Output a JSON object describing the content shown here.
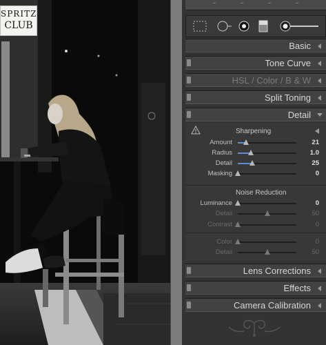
{
  "photo": {
    "sign_line1": "SPRITZ",
    "sign_line2": "CLUB"
  },
  "toolbar": {
    "tools": [
      "crop-overlay-icon",
      "spot-removal-icon",
      "red-eye-icon",
      "graduated-filter-icon",
      "adjustment-brush-icon"
    ]
  },
  "panel": {
    "sections": {
      "basic": "Basic",
      "tone_curve": "Tone Curve",
      "hsl": "HSL",
      "slash1": "/",
      "color": "Color",
      "slash2": "/",
      "bw": "B & W",
      "split_toning": "Split Toning",
      "detail": "Detail",
      "lens_corrections": "Lens Corrections",
      "effects": "Effects",
      "camera_calibration": "Camera Calibration"
    },
    "sharpening": {
      "title": "Sharpening",
      "rows": [
        {
          "name": "Amount",
          "value": "21",
          "fraction": 0.14
        },
        {
          "name": "Radius",
          "value": "1.0",
          "fraction": 0.22
        },
        {
          "name": "Detail",
          "value": "25",
          "fraction": 0.25
        },
        {
          "name": "Masking",
          "value": "0",
          "fraction": 0.0
        }
      ]
    },
    "noise_reduction": {
      "title": "Noise Reduction",
      "rows": [
        {
          "name": "Luminance",
          "value": "0",
          "fraction": 0.0,
          "dim": false
        },
        {
          "name": "Detail",
          "value": "50",
          "fraction": 0.5,
          "dim": true
        },
        {
          "name": "Contrast",
          "value": "0",
          "fraction": 0.0,
          "dim": true
        },
        {
          "name": "Color",
          "value": "0",
          "fraction": 0.0,
          "dim": true
        },
        {
          "name": "Detail",
          "value": "50",
          "fraction": 0.5,
          "dim": true
        }
      ]
    }
  }
}
